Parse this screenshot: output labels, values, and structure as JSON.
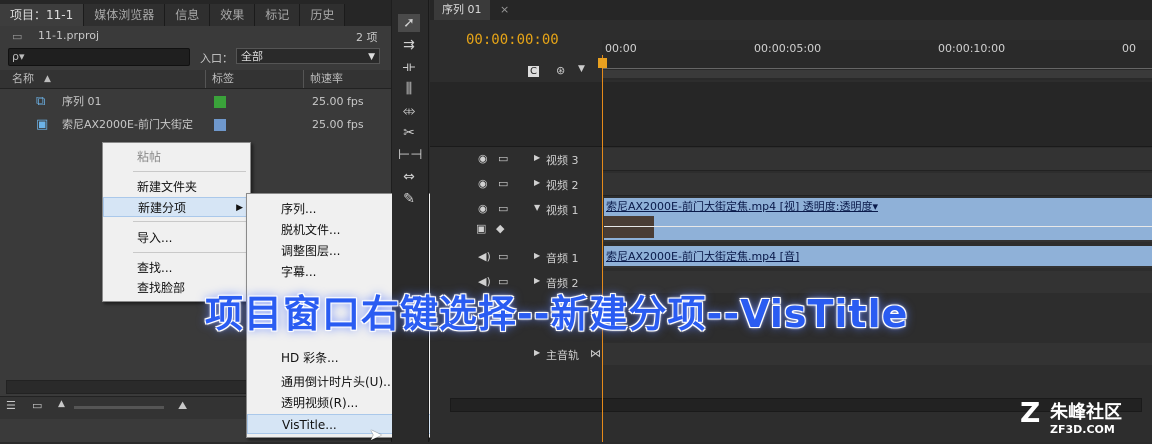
{
  "project_panel": {
    "tabs": [
      "项目：11-1",
      "媒体浏览器",
      "信息",
      "效果",
      "标记",
      "历史"
    ],
    "file_name": "11-1.prproj",
    "item_count": "2 项",
    "search_placeholder": "ρ▾",
    "entry_label": "入口：",
    "entry_value": "全部",
    "columns": {
      "name": "名称",
      "label": "标签",
      "framerate": "帧速率"
    },
    "items": [
      {
        "name": "序列 01",
        "framerate": "25.00 fps",
        "label_color": "#3aa23a"
      },
      {
        "name": "索尼AX2000E-前门大街定",
        "framerate": "25.00 fps",
        "label_color": "#6f98cc"
      }
    ]
  },
  "context_menu": {
    "items": [
      "粘帖",
      "新建文件夹",
      "新建分项",
      "导入...",
      "查找...",
      "查找脸部"
    ]
  },
  "submenu": {
    "items": [
      "序列...",
      "脱机文件...",
      "调整图层...",
      "字幕...",
      "HD 彩条...",
      "通用倒计时片头(U)...",
      "透明视频(R)...",
      "VisTitle..."
    ]
  },
  "sequence": {
    "tab": "序列 01",
    "timecode": "00:00:00:00",
    "ruler_labels": [
      "00:00",
      "00:00:05:00",
      "00:00:10:00",
      "00"
    ],
    "tracks": [
      "视频 3",
      "视频 2",
      "视频 1",
      "音频 1",
      "音频 2",
      "主音轨"
    ],
    "video_clip": "索尼AX2000E-前门大街定焦.mp4 [视] 透明度:透明度▾",
    "audio_clip": "索尼AX2000E-前门大街定焦.mp4 [音]"
  },
  "caption": "项目窗口右键选择--新建分项--VisTitle",
  "watermark": {
    "brand": "朱峰社区",
    "url": "ZF3D.COM"
  },
  "colors": {
    "timecode": "#e6a417",
    "clip": "#8fb1d8",
    "playhead": "#e58a1a",
    "caption": "#2a5cf2"
  }
}
